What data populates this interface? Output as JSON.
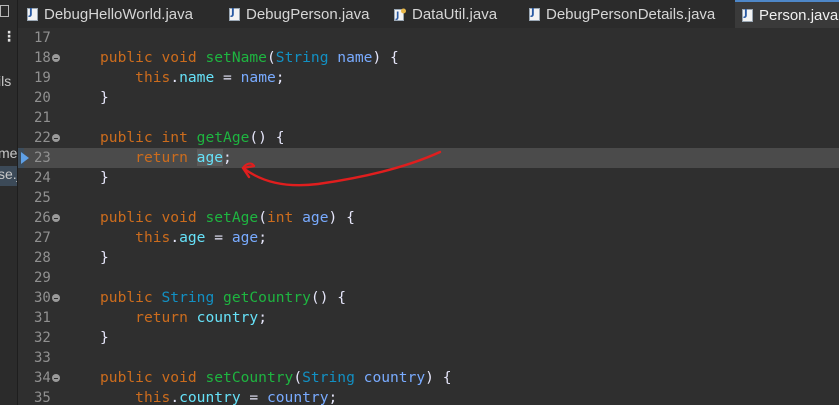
{
  "tabs": [
    {
      "label": "DebugHelloWorld.java",
      "icon": "java-file-icon",
      "active": false
    },
    {
      "label": "DebugPerson.java",
      "icon": "java-file-icon",
      "active": false
    },
    {
      "label": "DataUtil.java",
      "icon": "java-file-icon",
      "active": false
    },
    {
      "label": "DebugPersonDetails.java",
      "icon": "java-file-icon",
      "active": false
    },
    {
      "label": "Person.java",
      "icon": "java-file-icon",
      "active": true
    }
  ],
  "left_panel": {
    "fragments": [
      "ils",
      "me",
      "se.j"
    ]
  },
  "editor": {
    "current_line": 23,
    "lines": [
      {
        "n": "17",
        "tokens": []
      },
      {
        "n": "18",
        "fold": true,
        "tokens": [
          [
            "kw",
            "public"
          ],
          [
            "op",
            " "
          ],
          [
            "kw",
            "void"
          ],
          [
            "op",
            " "
          ],
          [
            "fn",
            "setName"
          ],
          [
            "op",
            "("
          ],
          [
            "ty",
            "String"
          ],
          [
            "op",
            " "
          ],
          [
            "pm",
            "name"
          ],
          [
            "op",
            ") {"
          ]
        ]
      },
      {
        "n": "19",
        "tokens": [
          [
            "op",
            "    "
          ],
          [
            "kw",
            "this"
          ],
          [
            "op",
            "."
          ],
          [
            "fd",
            "name"
          ],
          [
            "op",
            " = "
          ],
          [
            "pm",
            "name"
          ],
          [
            "op",
            ";"
          ]
        ]
      },
      {
        "n": "20",
        "tokens": [
          [
            "op",
            "}"
          ]
        ]
      },
      {
        "n": "21",
        "tokens": []
      },
      {
        "n": "22",
        "fold": true,
        "tokens": [
          [
            "kw",
            "public"
          ],
          [
            "op",
            " "
          ],
          [
            "kw",
            "int"
          ],
          [
            "op",
            " "
          ],
          [
            "fn",
            "getAge"
          ],
          [
            "op",
            "() {"
          ]
        ]
      },
      {
        "n": "23",
        "current": true,
        "breakpoint": true,
        "tokens": [
          [
            "op",
            "    "
          ],
          [
            "kw",
            "return"
          ],
          [
            "op",
            " "
          ],
          [
            "fd",
            "age"
          ],
          [
            "op",
            ";"
          ]
        ]
      },
      {
        "n": "24",
        "tokens": [
          [
            "op",
            "}"
          ]
        ]
      },
      {
        "n": "25",
        "tokens": []
      },
      {
        "n": "26",
        "fold": true,
        "tokens": [
          [
            "kw",
            "public"
          ],
          [
            "op",
            " "
          ],
          [
            "kw",
            "void"
          ],
          [
            "op",
            " "
          ],
          [
            "fn",
            "setAge"
          ],
          [
            "op",
            "("
          ],
          [
            "kw",
            "int"
          ],
          [
            "op",
            " "
          ],
          [
            "pm",
            "age"
          ],
          [
            "op",
            ") {"
          ]
        ]
      },
      {
        "n": "27",
        "tokens": [
          [
            "op",
            "    "
          ],
          [
            "kw",
            "this"
          ],
          [
            "op",
            "."
          ],
          [
            "fd",
            "age"
          ],
          [
            "op",
            " = "
          ],
          [
            "pm",
            "age"
          ],
          [
            "op",
            ";"
          ]
        ]
      },
      {
        "n": "28",
        "tokens": [
          [
            "op",
            "}"
          ]
        ]
      },
      {
        "n": "29",
        "tokens": []
      },
      {
        "n": "30",
        "fold": true,
        "tokens": [
          [
            "kw",
            "public"
          ],
          [
            "op",
            " "
          ],
          [
            "ty",
            "String"
          ],
          [
            "op",
            " "
          ],
          [
            "fn",
            "getCountry"
          ],
          [
            "op",
            "() {"
          ]
        ]
      },
      {
        "n": "31",
        "tokens": [
          [
            "op",
            "    "
          ],
          [
            "kw",
            "return"
          ],
          [
            "op",
            " "
          ],
          [
            "fd",
            "country"
          ],
          [
            "op",
            ";"
          ]
        ]
      },
      {
        "n": "32",
        "tokens": [
          [
            "op",
            "}"
          ]
        ]
      },
      {
        "n": "33",
        "tokens": []
      },
      {
        "n": "34",
        "fold": true,
        "tokens": [
          [
            "kw",
            "public"
          ],
          [
            "op",
            " "
          ],
          [
            "kw",
            "void"
          ],
          [
            "op",
            " "
          ],
          [
            "fn",
            "setCountry"
          ],
          [
            "op",
            "("
          ],
          [
            "ty",
            "String"
          ],
          [
            "op",
            " "
          ],
          [
            "pm",
            "country"
          ],
          [
            "op",
            ") {"
          ]
        ]
      },
      {
        "n": "35",
        "tokens": [
          [
            "op",
            "    "
          ],
          [
            "kw",
            "this"
          ],
          [
            "op",
            "."
          ],
          [
            "fd",
            "country"
          ],
          [
            "op",
            " = "
          ],
          [
            "pm",
            "country"
          ],
          [
            "op",
            ";"
          ]
        ]
      }
    ]
  },
  "colors": {
    "keyword": "#cc6c1d",
    "type": "#1290c3",
    "method": "#1eb540",
    "param": "#79abff",
    "field": "#66e1f8",
    "annotation_stroke": "#e01e1e"
  }
}
